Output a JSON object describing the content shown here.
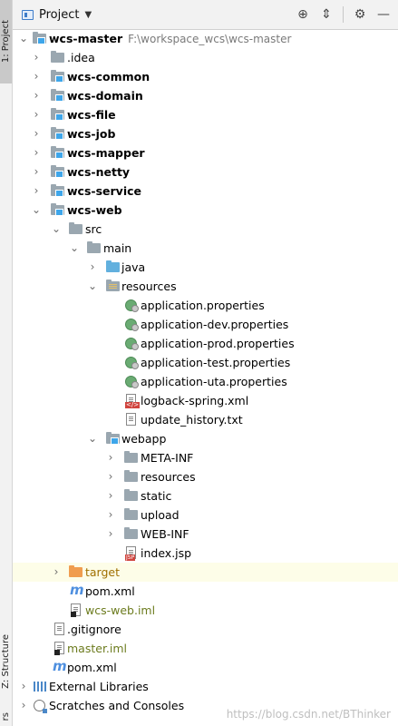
{
  "stripe": {
    "project_tab": "1: Project",
    "structure_tab": "Z: Structure",
    "bottom_tab": "rs"
  },
  "toolbar": {
    "title": "Project",
    "dropdown_icon": "chevron-down-icon",
    "buttons": [
      "locate-icon",
      "collapse-all-icon",
      "gear-icon",
      "hide-icon"
    ]
  },
  "tree": {
    "root": {
      "name": "wcs-master",
      "path": "F:\\workspace_wcs\\wcs-master"
    },
    "items": [
      {
        "label": ".idea"
      },
      {
        "label": "wcs-common"
      },
      {
        "label": "wcs-domain"
      },
      {
        "label": "wcs-file"
      },
      {
        "label": "wcs-job"
      },
      {
        "label": "wcs-mapper"
      },
      {
        "label": "wcs-netty"
      },
      {
        "label": "wcs-service"
      },
      {
        "label": "wcs-web"
      },
      {
        "label": "src"
      },
      {
        "label": "main"
      },
      {
        "label": "java"
      },
      {
        "label": "resources"
      },
      {
        "label": "application.properties"
      },
      {
        "label": "application-dev.properties"
      },
      {
        "label": "application-prod.properties"
      },
      {
        "label": "application-test.properties"
      },
      {
        "label": "application-uta.properties"
      },
      {
        "label": "logback-spring.xml"
      },
      {
        "label": "update_history.txt"
      },
      {
        "label": "webapp"
      },
      {
        "label": "META-INF"
      },
      {
        "label": "resources"
      },
      {
        "label": "static"
      },
      {
        "label": "upload"
      },
      {
        "label": "WEB-INF"
      },
      {
        "label": "index.jsp"
      },
      {
        "label": "target"
      },
      {
        "label": "pom.xml"
      },
      {
        "label": "wcs-web.iml"
      },
      {
        "label": ".gitignore"
      },
      {
        "label": "master.iml"
      },
      {
        "label": "pom.xml"
      },
      {
        "label": "External Libraries"
      },
      {
        "label": "Scratches and Consoles"
      }
    ]
  },
  "watermark": "https://blog.csdn.net/BThinker"
}
